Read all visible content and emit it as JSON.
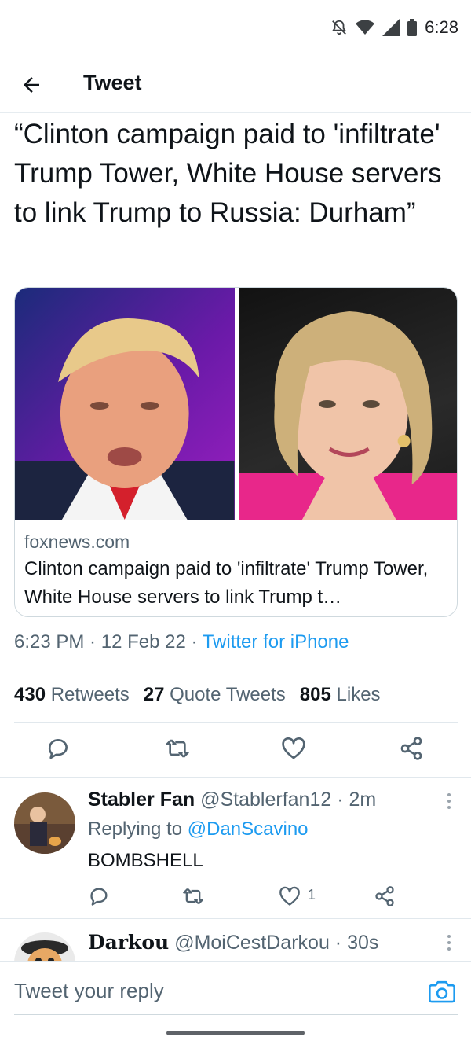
{
  "status_bar": {
    "time": "6:28",
    "icons": [
      "mute-icon",
      "wifi-icon",
      "signal-icon",
      "battery-icon"
    ]
  },
  "nav": {
    "title": "Tweet",
    "back_icon": "arrow-left-icon"
  },
  "tweet": {
    "text": "“Clinton campaign paid to 'infiltrate' Trump Tower, White House servers to link Trump to Russia: Durham”",
    "card": {
      "domain": "foxnews.com",
      "title": "Clinton campaign paid to 'infiltrate' Trump Tower, White House servers to link Trump t…"
    },
    "time": "6:23 PM",
    "sep1": " · ",
    "date": "12 Feb 22",
    "sep2": " · ",
    "source": "Twitter for iPhone",
    "stats": {
      "retweets_count": "430",
      "retweets_label": "Retweets",
      "quotes_count": "27",
      "quotes_label": "Quote Tweets",
      "likes_count": "805",
      "likes_label": "Likes"
    }
  },
  "replies": [
    {
      "name": "Stabler Fan",
      "handle": "@Stablerfan12",
      "sep": " · ",
      "time": "2m",
      "replying_to_label": "Replying to",
      "replying_to": "@DanScavino",
      "text": "BOMBSHELL",
      "like_count": "1"
    },
    {
      "name": "Darkou",
      "handle": "@MoiCestDarkou",
      "sep": " · ",
      "time": "30s"
    }
  ],
  "reply_bar": {
    "placeholder": "Tweet your reply",
    "icon": "camera-icon"
  },
  "colors": {
    "accent": "#1d9bf0",
    "text": "#0f1419",
    "muted": "#536471",
    "border": "#cfd9de"
  }
}
